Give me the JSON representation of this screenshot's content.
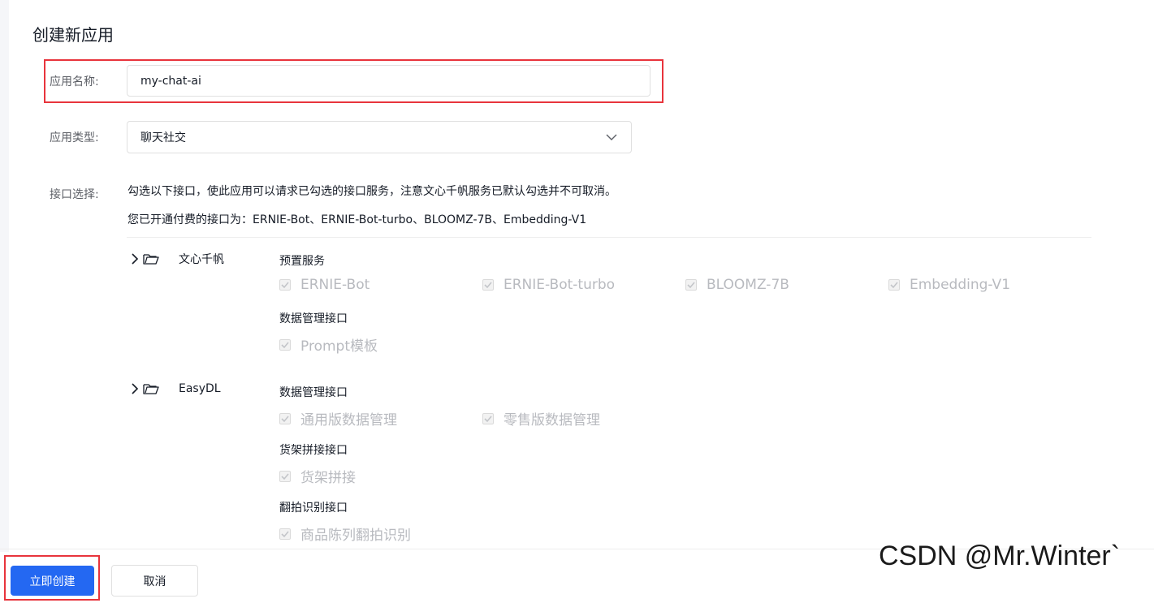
{
  "page": {
    "title": "创建新应用"
  },
  "form": {
    "name_label": "应用名称:",
    "name_value": "my-chat-ai",
    "type_label": "应用类型:",
    "type_value": "聊天社交",
    "api_label": "接口选择:",
    "api_desc": "勾选以下接口，使此应用可以请求已勾选的接口服务，注意文心千帆服务已默认勾选并不可取消。",
    "paid_desc": "您已开通付费的接口为：ERNIE-Bot、ERNIE-Bot-turbo、BLOOMZ-7B、Embedding-V1"
  },
  "groups": [
    {
      "name": "文心千帆",
      "sections": [
        {
          "title": "预置服务",
          "items": [
            "ERNIE-Bot",
            "ERNIE-Bot-turbo",
            "BLOOMZ-7B",
            "Embedding-V1"
          ]
        },
        {
          "title": "数据管理接口",
          "items": [
            "Prompt模板"
          ]
        }
      ]
    },
    {
      "name": "EasyDL",
      "sections": [
        {
          "title": "数据管理接口",
          "items": [
            "通用版数据管理",
            "零售版数据管理"
          ]
        },
        {
          "title": "货架拼接接口",
          "items": [
            "货架拼接"
          ]
        },
        {
          "title": "翻拍识别接口",
          "items": [
            "商品陈列翻拍识别"
          ]
        }
      ]
    }
  ],
  "footer": {
    "create_label": "立即创建",
    "cancel_label": "取消"
  },
  "watermark": "CSDN @Mr.Winter`",
  "colors": {
    "primary": "#2468f2",
    "highlight": "#e8343c",
    "disabled_text": "#b8babf"
  }
}
